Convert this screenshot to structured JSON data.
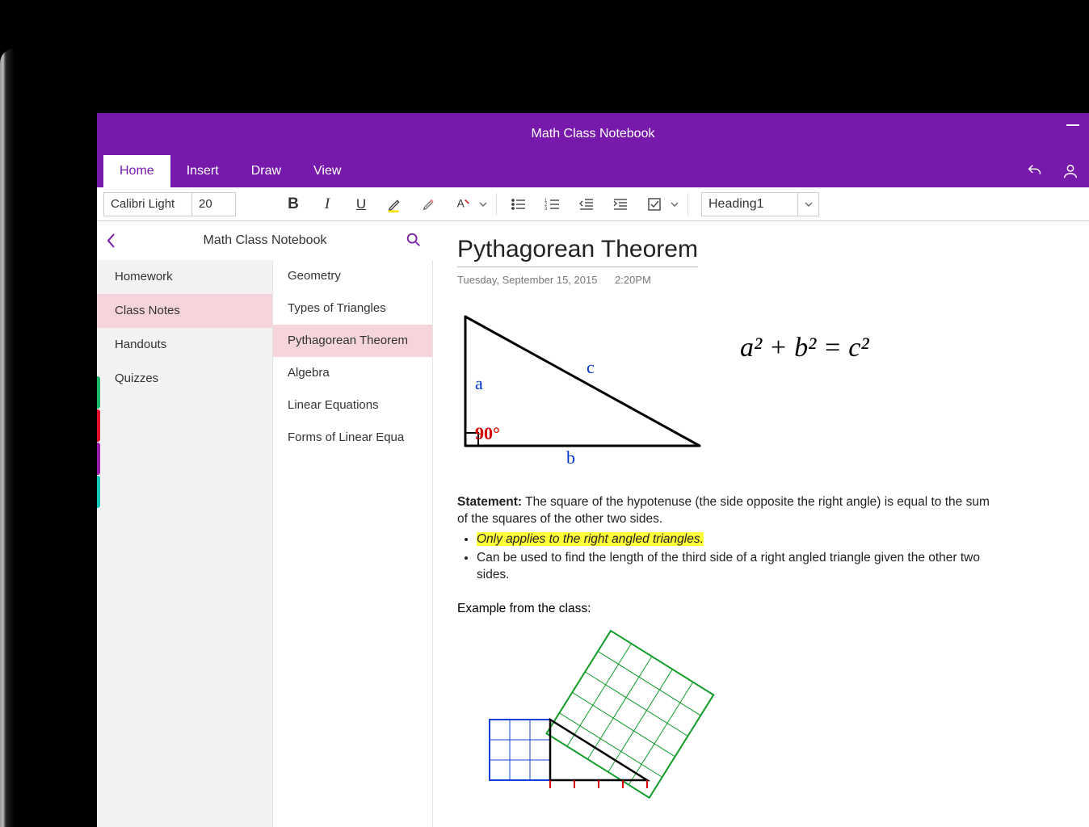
{
  "window": {
    "title": "Math Class Notebook"
  },
  "tabs": {
    "home": "Home",
    "insert": "Insert",
    "draw": "Draw",
    "view": "View",
    "active": "home"
  },
  "ribbon": {
    "font_name": "Calibri Light",
    "font_size": "20",
    "style": "Heading1"
  },
  "nav": {
    "title": "Math Class Notebook",
    "sections": [
      {
        "label": "Homework",
        "color": "#1fb96a"
      },
      {
        "label": "Class Notes",
        "color": "#e0102c",
        "active": true
      },
      {
        "label": "Handouts",
        "color": "#9a1aad"
      },
      {
        "label": "Quizzes",
        "color": "#18c9b8"
      }
    ],
    "pages": [
      {
        "label": "Geometry"
      },
      {
        "label": "Types of Triangles"
      },
      {
        "label": "Pythagorean Theorem",
        "active": true
      },
      {
        "label": "Algebra"
      },
      {
        "label": "Linear Equations"
      },
      {
        "label": "Forms of Linear Equa"
      }
    ]
  },
  "note": {
    "title": "Pythagorean Theorem",
    "date": "Tuesday, September 15, 2015",
    "time": "2:20PM",
    "triangle": {
      "a": "a",
      "b": "b",
      "c": "c",
      "angle": "90°"
    },
    "formula": "a² + b² = c²",
    "statement_label": "Statement:",
    "statement_text": "The square of the hypotenuse (the side opposite the right angle) is equal to the sum of the squares of the other two sides.",
    "bullet1": "Only applies to the right angled triangles.",
    "bullet2": "Can be used to find the length of the third side of a right angled triangle given the other two sides.",
    "example_label": "Example from the class:"
  }
}
